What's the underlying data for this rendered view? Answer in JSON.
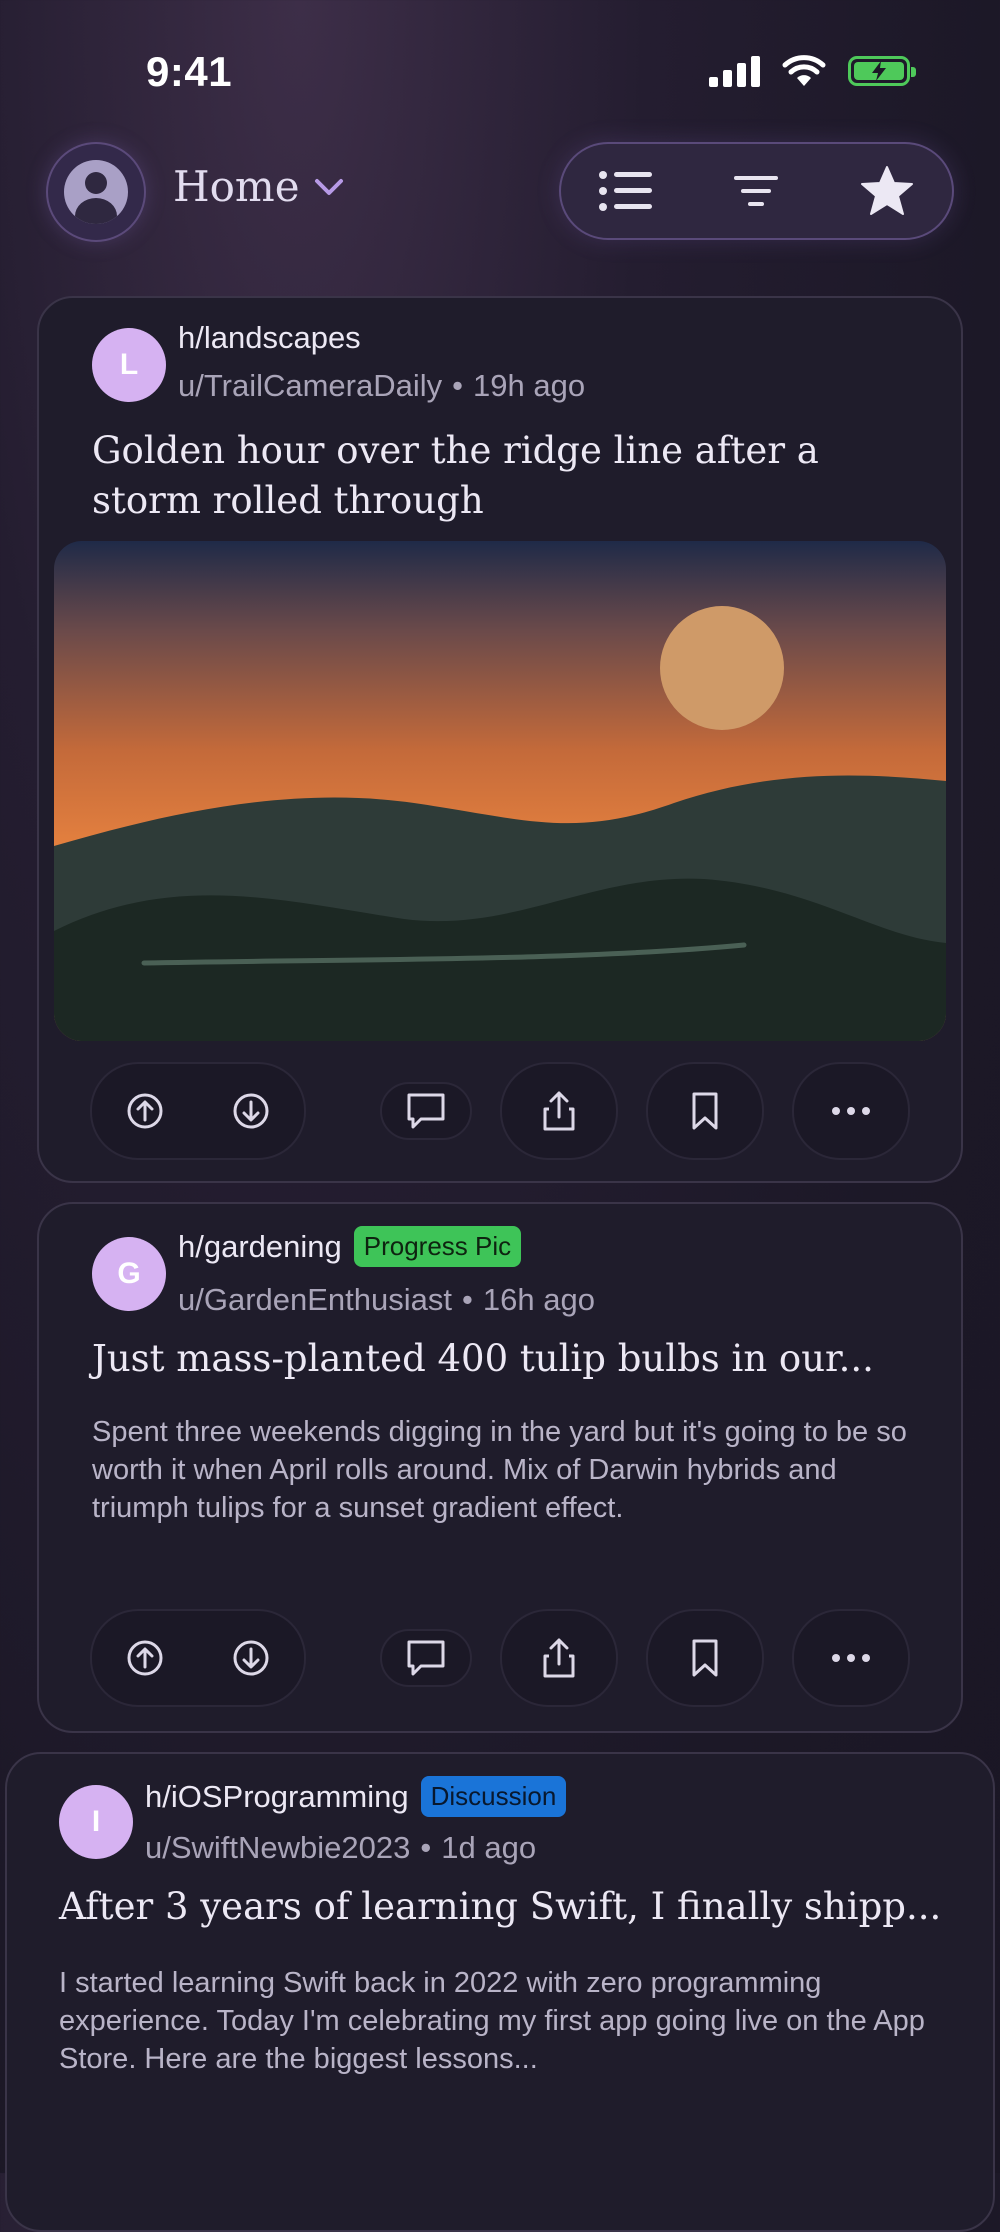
{
  "status_bar": {
    "time": "9:41"
  },
  "header": {
    "feed_label": "Home",
    "chevron": "chevron-down-icon"
  },
  "toolbar": {
    "icons": [
      "list-icon",
      "sort-icon",
      "star-icon"
    ]
  },
  "posts": [
    {
      "subreddit": "h/landscapes",
      "avatar_letter": "L",
      "author": "u/TrailCameraDaily",
      "separator": "•",
      "time": "19h ago",
      "title": "Golden hour over the ridge line after a storm rolled through"
    },
    {
      "subreddit": "h/gardening",
      "avatar_letter": "G",
      "flair": "Progress Pic",
      "author": "u/GardenEnthusiast",
      "separator": "•",
      "time": "16h ago",
      "title": "Just mass-planted 400 tulip bulbs in our...",
      "body": "Spent three weekends digging in the yard but it's going to be so worth it when April rolls around. Mix of Darwin hybrids and triumph tulips for a sunset gradient effect."
    },
    {
      "subreddit": "h/iOSProgramming",
      "avatar_letter": "I",
      "flair": "Discussion",
      "author": "u/SwiftNewbie2023",
      "separator": "•",
      "time": "1d ago",
      "title": "After 3 years of learning Swift, I finally shipp...",
      "body": "I started learning Swift back in 2022 with zero programming experience. Today I'm celebrating my first app going live on the App Store. Here are the biggest lessons..."
    }
  ],
  "colors": {
    "accent": "#b79ae6",
    "avatar": "#d6b2f2",
    "flair_green": "#3ec458",
    "flair_blue": "#1a74d8",
    "battery": "#4ec95a"
  }
}
